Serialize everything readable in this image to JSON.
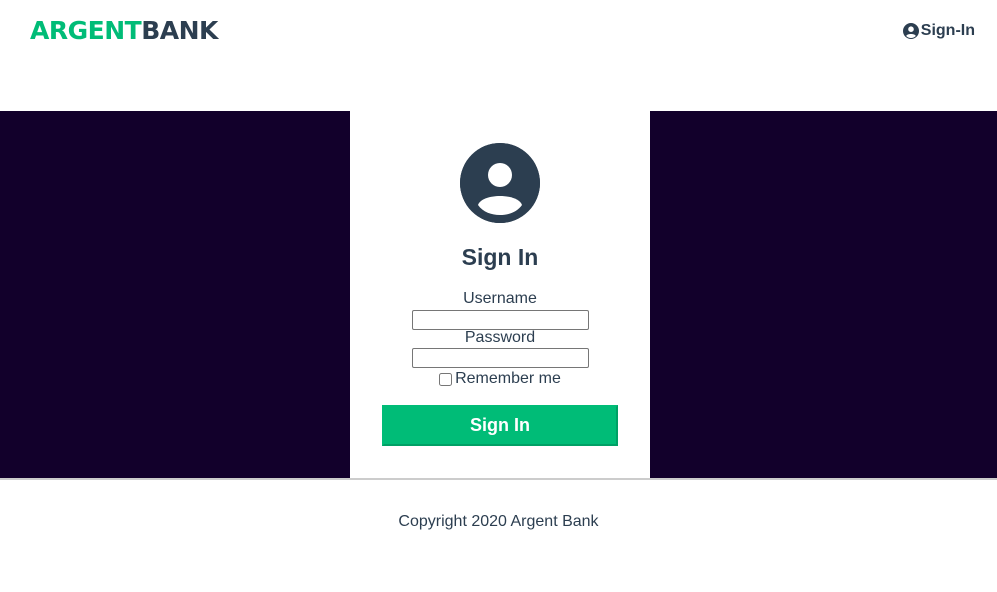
{
  "header": {
    "logo_part1": "ARGENT",
    "logo_part2": "BANK",
    "signin_link": "Sign-In",
    "signin_icon": "user-circle-icon"
  },
  "signin_form": {
    "avatar_icon": "user-circle-icon",
    "title": "Sign In",
    "username_label": "Username",
    "username_value": "",
    "password_label": "Password",
    "password_value": "",
    "remember_label": "Remember me",
    "remember_checked": false,
    "submit_label": "Sign In"
  },
  "footer": {
    "copyright": "Copyright 2020 Argent Bank"
  },
  "colors": {
    "brand_green": "#00bc77",
    "text_dark": "#2c3e50",
    "hero_background": "#12002b",
    "footer_border": "#cccccc"
  }
}
